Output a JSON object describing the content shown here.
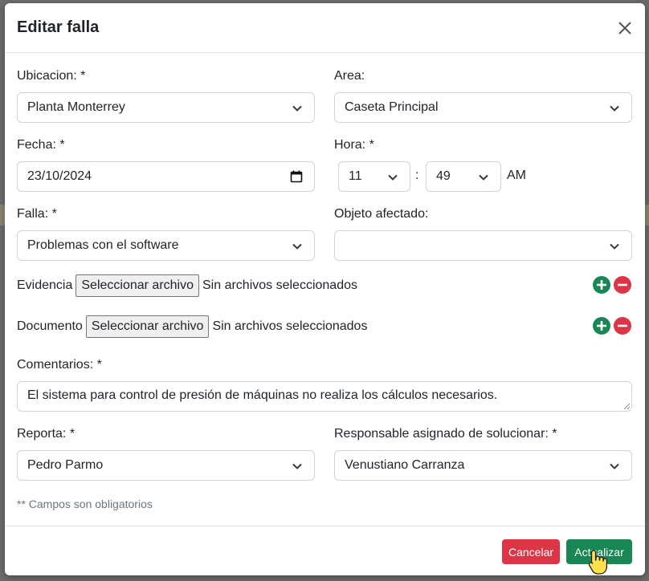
{
  "modal": {
    "title": "Editar falla",
    "close_icon": "close-icon"
  },
  "form": {
    "ubicacion": {
      "label": "Ubicacion: *",
      "value": "Planta Monterrey"
    },
    "area": {
      "label": "Area:",
      "value": "Caseta Principal"
    },
    "fecha": {
      "label": "Fecha: *",
      "value": "23/10/2024"
    },
    "hora": {
      "label": "Hora: *",
      "hour": "11",
      "separator": ":",
      "minute": "49",
      "ampm": "AM"
    },
    "falla": {
      "label": "Falla: *",
      "value": "Problemas con el software"
    },
    "objeto": {
      "label": "Objeto afectado:",
      "value": ""
    },
    "evidencia": {
      "label": "Evidencia",
      "button": "Seleccionar archivo",
      "status": "Sin archivos seleccionados"
    },
    "documento": {
      "label": "Documento",
      "button": "Seleccionar archivo",
      "status": "Sin archivos seleccionados"
    },
    "comentarios": {
      "label": "Comentarios: *",
      "value": "El sistema para control de presión de máquinas no realiza los cálculos necesarios."
    },
    "reporta": {
      "label": "Reporta: *",
      "value": "Pedro Parmo"
    },
    "responsable": {
      "label": "Responsable asignado de solucionar: *",
      "value": "Venustiano Carranza"
    },
    "note": "** Campos son obligatorios"
  },
  "footer": {
    "cancel_label": "Cancelar",
    "update_label": "Actualizar"
  },
  "colors": {
    "success": "#198754",
    "danger": "#dc3545",
    "border": "#ced4da"
  }
}
